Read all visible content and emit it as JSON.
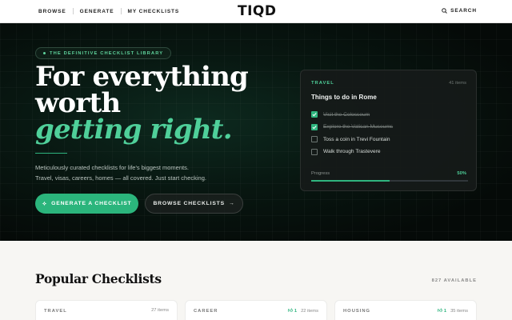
{
  "nav": {
    "links": [
      "BROWSE",
      "GENERATE",
      "MY CHECKLISTS"
    ],
    "logo": "TIQD",
    "search_label": "SEARCH"
  },
  "hero": {
    "eyebrow": "THE DEFINITIVE CHECKLIST LIBRARY",
    "headline_line1": "For everything",
    "headline_line2": "worth",
    "headline_accent": "getting right.",
    "desc_line1": "Meticulously curated checklists for life's biggest moments.",
    "desc_line2": "Travel, visas, careers, homes — all covered. Just start checking.",
    "primary_button": "GENERATE A CHECKLIST",
    "secondary_button": "BROWSE CHECKLISTS"
  },
  "preview": {
    "category": "TRAVEL",
    "count": "41 items",
    "title": "Things to do in Rome",
    "items": [
      {
        "label": "Visit the Colosseum",
        "checked": true
      },
      {
        "label": "Explore the Vatican Museums",
        "checked": true
      },
      {
        "label": "Toss a coin in Trevi Fountain",
        "checked": false
      },
      {
        "label": "Walk through Trastevere",
        "checked": false
      }
    ],
    "progress_label": "Progress",
    "progress_text": "50%",
    "progress_value": 0.5
  },
  "popular": {
    "title": "Popular Checklists",
    "available": "827 AVAILABLE",
    "cards": [
      {
        "category": "TRAVEL",
        "votes": "",
        "items": "27 items"
      },
      {
        "category": "CAREER",
        "votes": "1",
        "items": "22 items"
      },
      {
        "category": "HOUSING",
        "votes": "1",
        "items": "35 items"
      }
    ]
  },
  "colors": {
    "accent": "#2fb57f",
    "accent_light": "#4fd09a",
    "hero_bg": "#081711"
  }
}
